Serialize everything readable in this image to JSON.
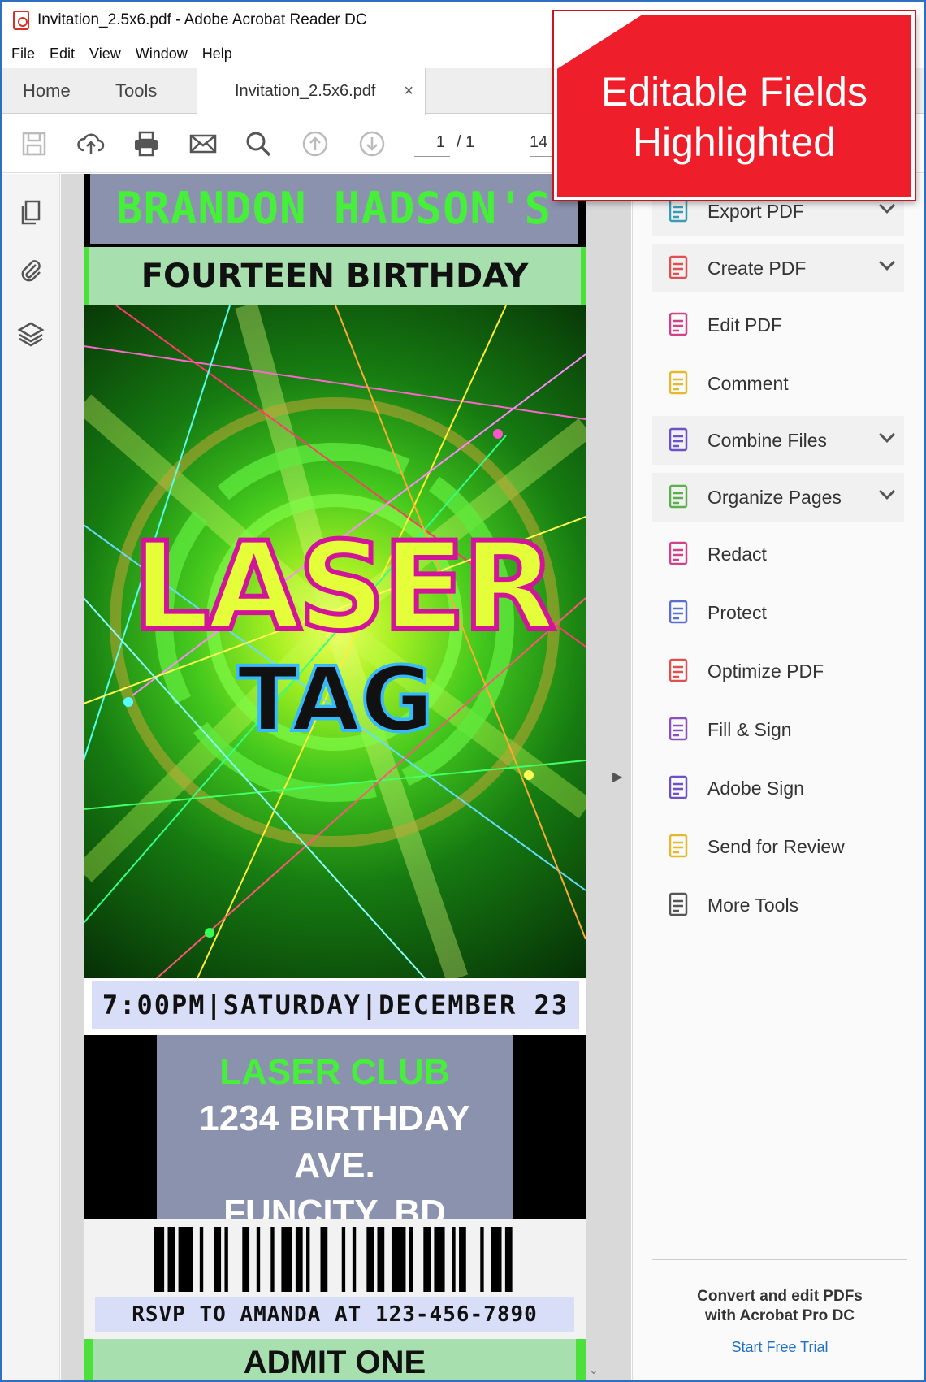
{
  "window": {
    "title": "Invitation_2.5x6.pdf - Adobe Acrobat Reader DC"
  },
  "menu": [
    "File",
    "Edit",
    "View",
    "Window",
    "Help"
  ],
  "tabs": {
    "home": "Home",
    "tools": "Tools",
    "document": "Invitation_2.5x6.pdf",
    "close": "×"
  },
  "toolbar": {
    "current_page": "1",
    "page_sep": "/ 1",
    "zoom": "14",
    "icons": [
      "save-icon",
      "upload-icon",
      "print-icon",
      "email-icon",
      "search-icon",
      "page-up-icon",
      "page-down-icon"
    ]
  },
  "callout": {
    "line1": "Editable Fields",
    "line2": "Highlighted",
    "color": "#ee1f2a"
  },
  "invitation": {
    "name": "BRANDON HADSON'S",
    "occasion": "FOURTEEN BIRTHDAY",
    "title_main": "LASER",
    "title_sub": "TAG",
    "datetime": "7:00PM|SATURDAY|DECEMBER 23",
    "venue_name": "LASER CLUB",
    "address_line1": "1234 BIRTHDAY AVE.",
    "address_line2": "FUNCITY, BD",
    "rsvp": "RSVP TO AMANDA AT 123-456-7890",
    "admit": "ADMIT ONE",
    "field_highlight_color": "#8a92ad",
    "accent_green": "#46f03a"
  },
  "tools_pane": {
    "items": [
      {
        "label": "Export PDF",
        "icon": "export-pdf-icon",
        "chevron": true
      },
      {
        "label": "Create PDF",
        "icon": "create-pdf-icon",
        "chevron": true
      },
      {
        "label": "Edit PDF",
        "icon": "edit-pdf-icon",
        "chevron": false
      },
      {
        "label": "Comment",
        "icon": "comment-icon",
        "chevron": false
      },
      {
        "label": "Combine Files",
        "icon": "combine-files-icon",
        "chevron": true
      },
      {
        "label": "Organize Pages",
        "icon": "organize-pages-icon",
        "chevron": true
      },
      {
        "label": "Redact",
        "icon": "redact-icon",
        "chevron": false
      },
      {
        "label": "Protect",
        "icon": "protect-icon",
        "chevron": false
      },
      {
        "label": "Optimize PDF",
        "icon": "optimize-pdf-icon",
        "chevron": false
      },
      {
        "label": "Fill & Sign",
        "icon": "fill-sign-icon",
        "chevron": false
      },
      {
        "label": "Adobe Sign",
        "icon": "adobe-sign-icon",
        "chevron": false
      },
      {
        "label": "Send for Review",
        "icon": "send-for-review-icon",
        "chevron": false
      },
      {
        "label": "More Tools",
        "icon": "more-tools-icon",
        "chevron": false
      }
    ],
    "promo_line1": "Convert and edit PDFs",
    "promo_line2": "with Acrobat Pro DC",
    "promo_link": "Start Free Trial"
  }
}
